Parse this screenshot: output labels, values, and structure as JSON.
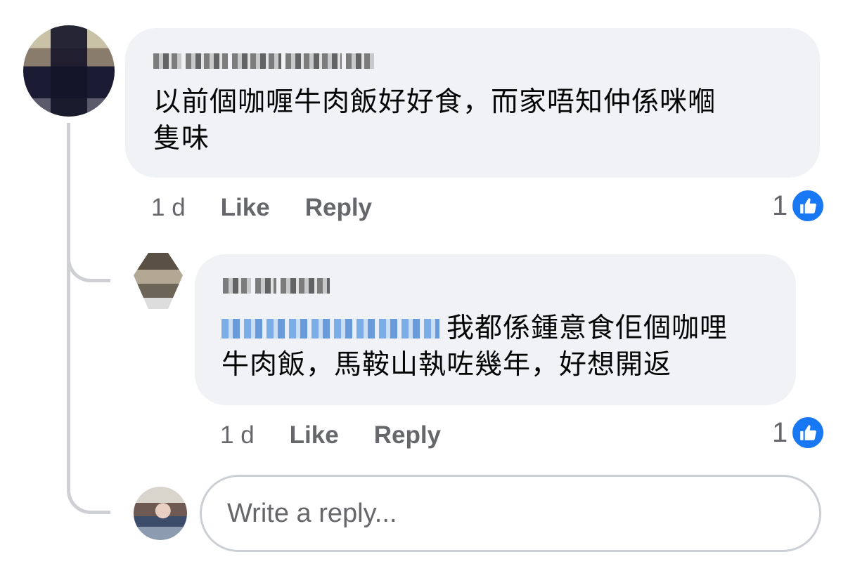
{
  "comments": [
    {
      "author": "",
      "text_line1": "以前個咖喱牛肉飯好好食，而家唔知仲係咪嗰",
      "text_line2": "隻味",
      "time": "1 d",
      "like_label": "Like",
      "reply_label": "Reply",
      "reaction_count": "1"
    },
    {
      "author": "",
      "mention": "",
      "text_line1": "我都係鍾意食佢個咖哩",
      "text_line2": "牛肉飯，馬鞍山執咗幾年，好想開返",
      "time": "1 d",
      "like_label": "Like",
      "reply_label": "Reply",
      "reaction_count": "1"
    }
  ],
  "reply_box": {
    "placeholder": "Write a reply..."
  },
  "colors": {
    "bubble": "#f0f2f5",
    "like_blue": "#1877f2",
    "meta_gray": "#65676b",
    "thread_line": "#ced0d4"
  },
  "icons": {
    "reaction": "thumbs-up-icon"
  }
}
